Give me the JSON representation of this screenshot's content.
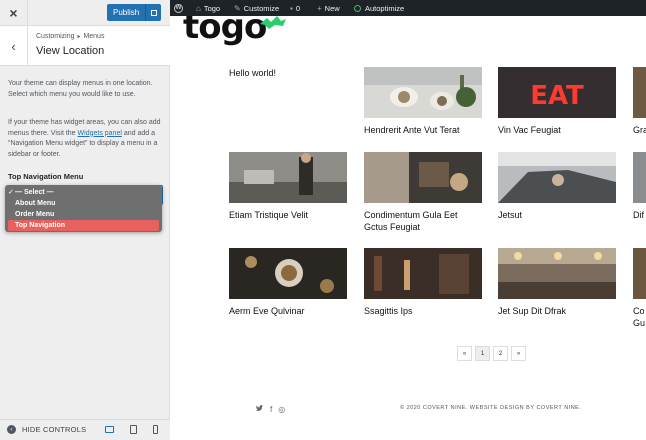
{
  "panel": {
    "close_icon": "×",
    "publish_label": "Publish",
    "breadcrumb_parent": "Customizing",
    "breadcrumb_section": "Menus",
    "breadcrumb_sep": "▸",
    "section_title": "View Location",
    "back_icon": "‹",
    "description_1": "Your theme can display menus in one location. Select which menu you would like to use.",
    "description_2_before": "If your theme has widget areas, you can also add menus there. Visit the ",
    "description_2_link": "Widgets panel",
    "description_2_after": " and add a “Navigation Menu widget” to display a menu in a sidebar or footer.",
    "location_label": "Top Navigation Menu",
    "dropdown": {
      "check": "✓",
      "options": [
        "— Select —",
        "About Menu",
        "Order Menu",
        "Top Navigation"
      ],
      "highlighted": "Top Navigation"
    },
    "footer": {
      "hide_controls_label": "HIDE CONTROLS",
      "hide_icon": "‹",
      "devices": [
        "desktop-icon",
        "tablet-icon",
        "mobile-icon"
      ],
      "active_device": "desktop"
    },
    "accent_color": "#2271b1",
    "highlight_color": "#e8615f"
  },
  "adminbar": {
    "site_name": "Togo",
    "customize_label": "Customize",
    "comments_count": "0",
    "new_label": "New",
    "autoptimize_label": "Autoptimize",
    "icons": [
      "wordpress-icon",
      "home-icon",
      "brush-icon",
      "comment-icon",
      "plus-icon",
      "status-ring-icon"
    ]
  },
  "site": {
    "logo_text": "togo",
    "logo_color": "#2ecc71",
    "posts": [
      {
        "title": "Hello world!",
        "image": null
      },
      {
        "title": "Hendrerit Ante Vut Terat",
        "image": "dining-table"
      },
      {
        "title": "Vin Vac Feugiat",
        "image": "eat-neon-sign"
      },
      {
        "title": "Gra",
        "image": "food"
      },
      {
        "title": "Etiam Tristique Velit",
        "image": "chef-kitchen"
      },
      {
        "title": "Condimentum Gula Eet Gctus Feugiat",
        "image": "pizza-oven"
      },
      {
        "title": "Jetsut",
        "image": "car-interior"
      },
      {
        "title": "Dif",
        "image": "street"
      },
      {
        "title": "Aerm Eve Qulvinar",
        "image": "plated-food"
      },
      {
        "title": "Ssagittis Ips",
        "image": "bar-wine"
      },
      {
        "title": "Jet Sup Dit Dfrak",
        "image": "restaurant-interior"
      },
      {
        "title": "Co Gu",
        "image": "cafe"
      }
    ],
    "pagination": [
      "«",
      "1",
      "2",
      "»"
    ],
    "current_page": "1",
    "social_icons": [
      "twitter-icon",
      "facebook-icon",
      "instagram-icon"
    ],
    "social_glyphs": [
      "🐦",
      "f",
      "◎"
    ],
    "copyright": "© 2020 COVERT NINE. WEBSITE DESIGN BY COVERT NINE."
  }
}
